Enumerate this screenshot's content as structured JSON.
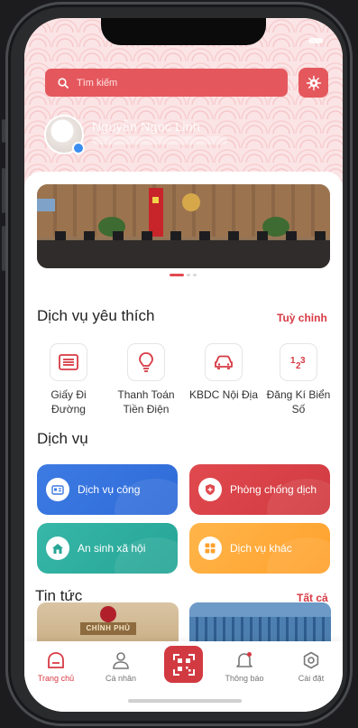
{
  "header": {
    "search_placeholder": "Tìm kiếm",
    "user_name": "Nguyễn Ngọc Linh"
  },
  "banner": {
    "slide_count": 3,
    "active_slide": 1
  },
  "favorites": {
    "title": "Dịch vụ yêu thích",
    "edit_link": "Tuỳ chỉnh",
    "items": [
      {
        "label": "Giấy Đi Đường",
        "icon": "document-list-icon"
      },
      {
        "label": "Thanh Toán Tiền Điện",
        "icon": "light-bulb-icon"
      },
      {
        "label": "KBDC Nội Địa",
        "icon": "car-icon"
      },
      {
        "label": "Đăng Kí Biển Số",
        "icon": "numbers-123-icon"
      }
    ]
  },
  "services": {
    "title": "Dịch vụ",
    "items": [
      {
        "label": "Dịch vụ công",
        "color": "#3d7be3",
        "icon": "id-card-icon"
      },
      {
        "label": "Phòng chống dịch",
        "color": "#e04a4f",
        "icon": "shield-icon"
      },
      {
        "label": "An sinh xã hội",
        "color": "#37b7a7",
        "icon": "house-icon"
      },
      {
        "label": "Dịch vụ khác",
        "color": "#ffb54a",
        "icon": "grid-icon"
      }
    ]
  },
  "news": {
    "title": "Tin tức",
    "all_link": "Tất cả",
    "cards": [
      {
        "plaque": "CHÍNH PHỦ"
      }
    ]
  },
  "tabbar": {
    "items": [
      {
        "label": "Trang chủ",
        "icon": "home-icon",
        "active": true
      },
      {
        "label": "Cá nhân",
        "icon": "person-icon",
        "active": false
      },
      {
        "label": "",
        "icon": "qr-scan-icon",
        "active": false
      },
      {
        "label": "Thông báo",
        "icon": "bell-icon",
        "active": false
      },
      {
        "label": "Cài đặt",
        "icon": "settings-icon",
        "active": false
      }
    ]
  },
  "colors": {
    "accent": "#d73a44",
    "header_bg": "#fbe4e5"
  }
}
